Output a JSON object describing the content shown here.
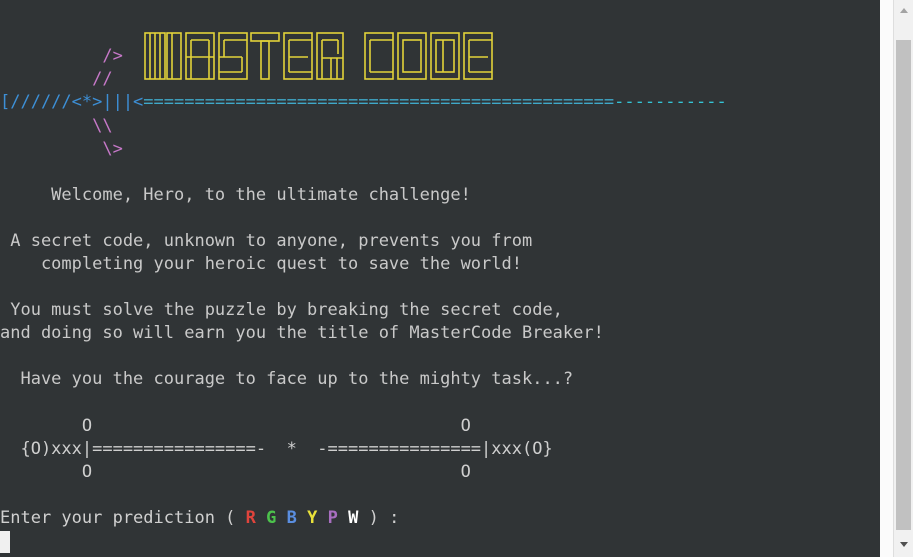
{
  "title_logo": "MASTER CODE",
  "sword": {
    "line1": "        />",
    "line2": "       //",
    "hilt": "[//////<*>|||<",
    "blade_main": "==============================================",
    "blade_tail": "-----------",
    "line4": "       \\\\",
    "line5": "        \\>"
  },
  "intro": {
    "welcome": "     Welcome, Hero, to the ultimate challenge!",
    "secret1": " A secret code, unknown to anyone, prevents you from",
    "secret2": "    completing your heroic quest to save the world!",
    "solve1": " You must solve the puzzle by breaking the secret code,",
    "solve2": "and doing so will earn you the title of MasterCode Breaker!",
    "courage": "  Have you the courage to face up to the mighty task...?"
  },
  "shields": {
    "top": "        O                                    O",
    "mid": "  {O)xxx|================-  *  -===============|xxx(O}",
    "bottom": "        O                                    O"
  },
  "prompt": {
    "text": "Enter your prediction ( ",
    "colors": [
      "R",
      "G",
      "B",
      "Y",
      "P",
      "W"
    ],
    "end": ") :"
  }
}
